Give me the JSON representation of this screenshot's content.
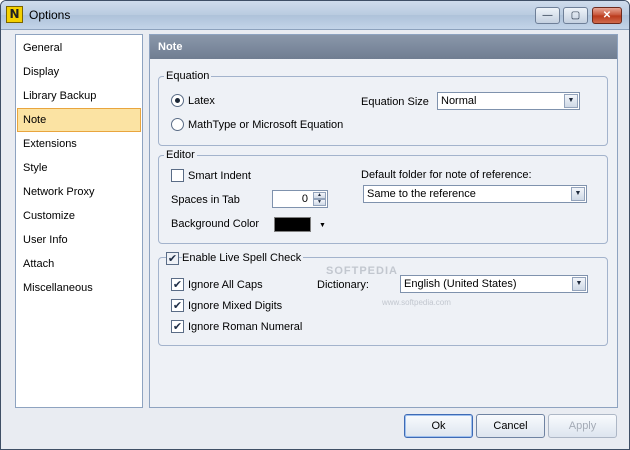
{
  "window": {
    "title": "Options",
    "app_icon_letter": "N"
  },
  "titlebar_buttons": {
    "minimize": "—",
    "maximize": "▢",
    "close": "✕"
  },
  "sidebar": {
    "items": [
      {
        "label": "General"
      },
      {
        "label": "Display"
      },
      {
        "label": "Library Backup"
      },
      {
        "label": "Note",
        "selected": true
      },
      {
        "label": "Extensions"
      },
      {
        "label": "Style"
      },
      {
        "label": "Network Proxy"
      },
      {
        "label": "Customize"
      },
      {
        "label": "User Info"
      },
      {
        "label": "Attach"
      },
      {
        "label": "Miscellaneous"
      }
    ]
  },
  "panel": {
    "title": "Note"
  },
  "equation": {
    "group_label": "Equation",
    "option_latex": {
      "label": "Latex",
      "selected": true
    },
    "option_mathtype": {
      "label": "MathType or Microsoft Equation",
      "selected": false
    },
    "size_label": "Equation Size",
    "size_value": "Normal"
  },
  "editor": {
    "group_label": "Editor",
    "smart_indent": {
      "label": "Smart Indent",
      "checked": false
    },
    "spaces_in_tab_label": "Spaces in Tab",
    "spaces_in_tab_value": "0",
    "background_color_label": "Background Color",
    "background_color_value": "#000000",
    "default_folder_label": "Default folder for note of reference:",
    "default_folder_value": "Same to the reference"
  },
  "spell": {
    "enable": {
      "label": "Enable Live Spell Check",
      "checked": true
    },
    "ignore_caps": {
      "label": "Ignore All Caps",
      "checked": true
    },
    "ignore_digits": {
      "label": "Ignore Mixed Digits",
      "checked": true
    },
    "ignore_roman": {
      "label": "Ignore Roman Numeral",
      "checked": true
    },
    "dictionary_label": "Dictionary:",
    "dictionary_value": "English (United States)"
  },
  "watermark": {
    "main": "SOFTPEDIA",
    "sub": "www.softpedia.com"
  },
  "buttons": {
    "ok": "Ok",
    "cancel": "Cancel",
    "apply": "Apply"
  },
  "icons": {
    "checkmark": "✔",
    "dropdown_arrow": "▼",
    "spin_up": "▲",
    "spin_down": "▼"
  }
}
